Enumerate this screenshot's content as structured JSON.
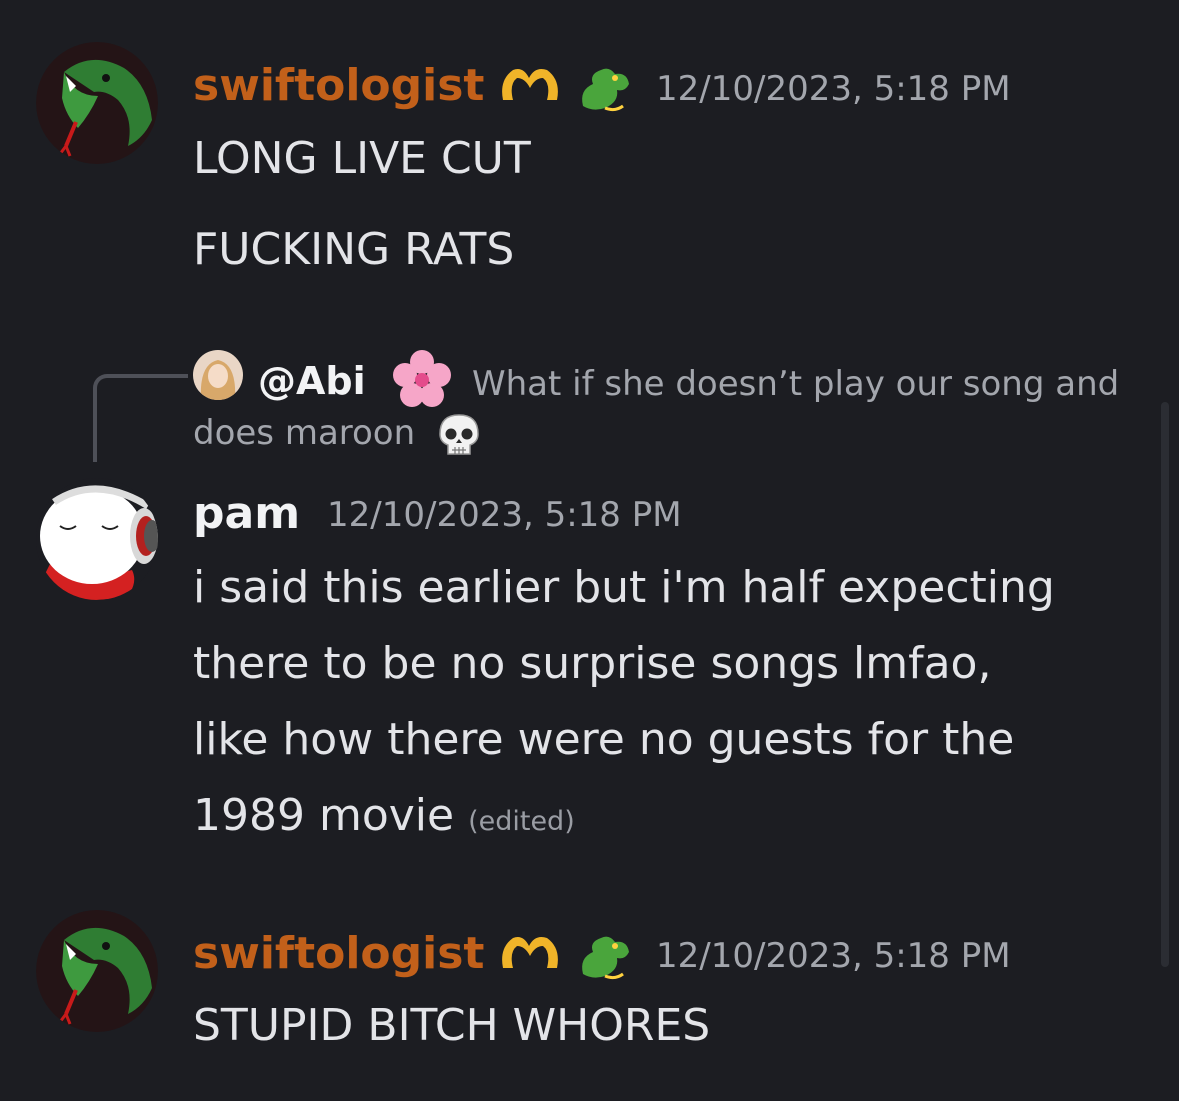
{
  "messages": [
    {
      "username": "swiftologist",
      "timestamp": "12/10/2023, 5:18 PM",
      "badges": [
        "heart-hands-icon",
        "dragon-icon"
      ],
      "lines": [
        "LONG LIVE CUT",
        "FUCKING RATS"
      ]
    },
    {
      "reply": {
        "mention": "@Abi",
        "badge": "cherry-blossom-icon",
        "text_line1": "What if she doesn’t play our song and",
        "text_line2": "does maroon",
        "trailing_emoji": "skull-icon"
      },
      "username": "pam",
      "timestamp": "12/10/2023, 5:18 PM",
      "lines": [
        "i said this earlier but i'm half expecting",
        "there to be no surprise songs lmfao,",
        "like how there were no guests for the",
        "1989 movie"
      ],
      "edited_label": "(edited)"
    },
    {
      "username": "swiftologist",
      "timestamp": "12/10/2023, 5:18 PM",
      "badges": [
        "heart-hands-icon",
        "dragon-icon"
      ],
      "lines": [
        "STUPID BITCH WHORES"
      ]
    }
  ],
  "colors": {
    "background": "#1c1d22",
    "username_accent": "#c2601a",
    "timestamp": "#a3a6ad",
    "message_text": "#e3e4e8"
  }
}
